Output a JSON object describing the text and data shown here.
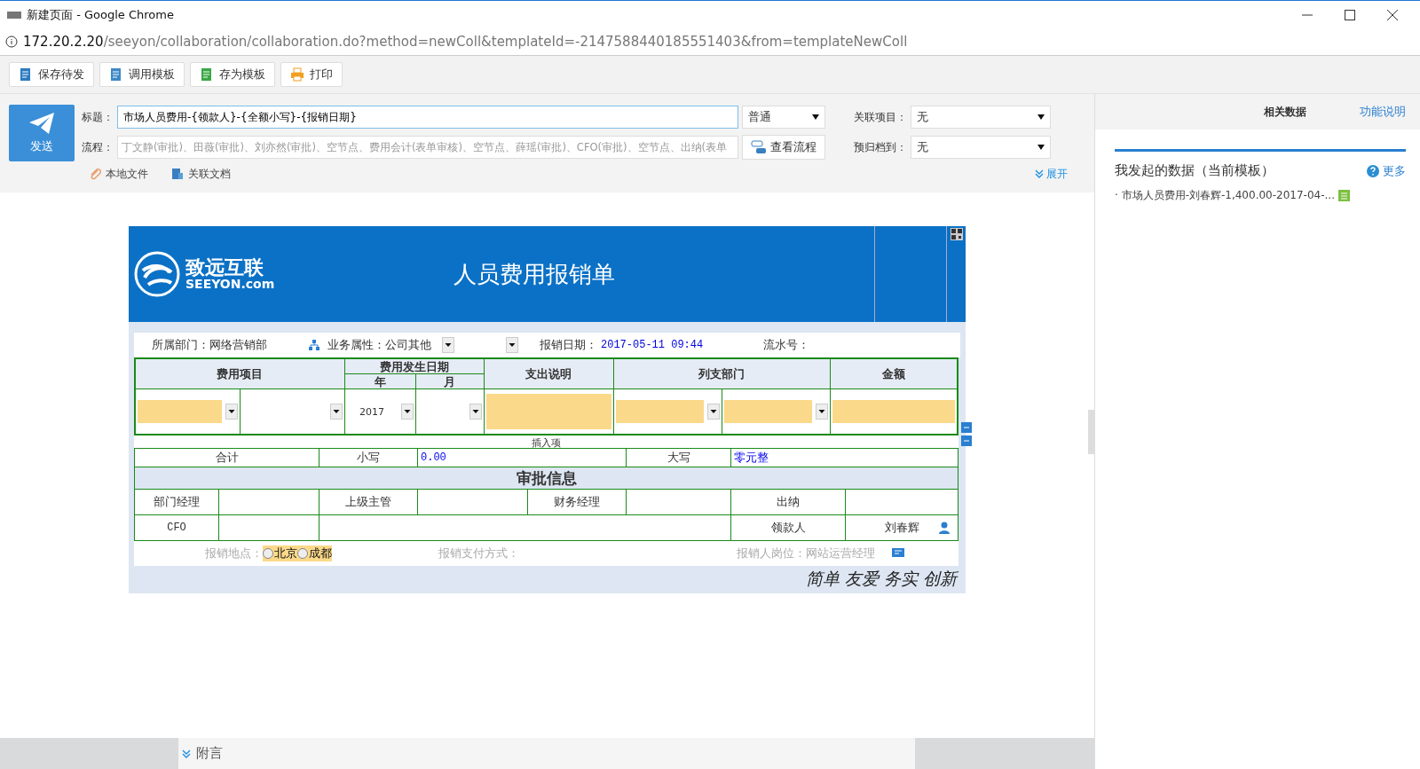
{
  "window": {
    "title": "新建页面 - Google Chrome",
    "url_host": "172.20.2.20",
    "url_path": "/seeyon/collaboration/collaboration.do?method=newColl&templateId=-2147588440185551403&from=templateNewColl"
  },
  "toolbar": [
    {
      "label": "保存待发",
      "kind": "save"
    },
    {
      "label": "调用模板",
      "kind": "template"
    },
    {
      "label": "存为模板",
      "kind": "saveas"
    },
    {
      "label": "打印",
      "kind": "print"
    }
  ],
  "send_button": "发送",
  "subject": {
    "label": "标题：",
    "value": "市场人员费用-{领款人}-{全额小写}-{报销日期}"
  },
  "priority": "普通",
  "flow": {
    "label": "流程：",
    "value": "丁文静(审批)、田薇(审批)、刘亦然(审批)、空节点、费用会计(表单审核)、空节点、薛瑶(审批)、CFO(审批)、空节点、出纳(表单"
  },
  "view_flow_button": "查看流程",
  "related_project": {
    "label": "关联项目：",
    "value": "无"
  },
  "archive": {
    "label": "预归档到：",
    "value": "无"
  },
  "attachments": [
    {
      "label": "本地文件",
      "kind": "clip"
    },
    {
      "label": "关联文档",
      "kind": "doc"
    }
  ],
  "expand_link": "展开",
  "side_panel": {
    "title": "相关数据",
    "help_link": "功能说明",
    "section_title": "我发起的数据（当前模板）",
    "more_link": "更多",
    "items": [
      "· 市场人员费用-刘春辉-1,400.00-2017-04-..."
    ]
  },
  "form": {
    "logo_text": "致远互联",
    "logo_sub": "SEEYON.com",
    "title": "人员费用报销单",
    "info": {
      "dept_label": "所属部门：",
      "dept": "网络营销部",
      "biz_label": "业务属性：",
      "biz": "公司其他",
      "date_label": "报销日期：",
      "date": "2017-05-11 09:44",
      "serial_label": "流水号："
    },
    "headers": {
      "item": "费用项目",
      "date": "费用发生日期",
      "year": "年",
      "month": "月",
      "desc": "支出说明",
      "dept": "列支部门",
      "amount": "金额"
    },
    "year_value": "2017",
    "insert_link": "插入项",
    "total": {
      "label": "合计",
      "small_label": "小写",
      "small": "0.00",
      "big_label": "大写",
      "big": "零元整"
    },
    "approval_title": "审批信息",
    "approval": {
      "dept_manager": "部门经理",
      "superior": "上级主管",
      "finance_manager": "财务经理",
      "cashier": "出纳",
      "cfo": "CFO",
      "payee_label": "领款人",
      "payee": "刘春辉"
    },
    "location": {
      "label": "报销地点：",
      "options": [
        {
          "label": "北京",
          "selected": false
        },
        {
          "label": "成都",
          "selected": false
        }
      ]
    },
    "payment_label": "报销支付方式：",
    "position": {
      "label": "报销人岗位：",
      "value": "网站运营经理"
    },
    "slogan": "简单 友爱 务实 创新"
  },
  "bottom": {
    "label": "附言"
  }
}
